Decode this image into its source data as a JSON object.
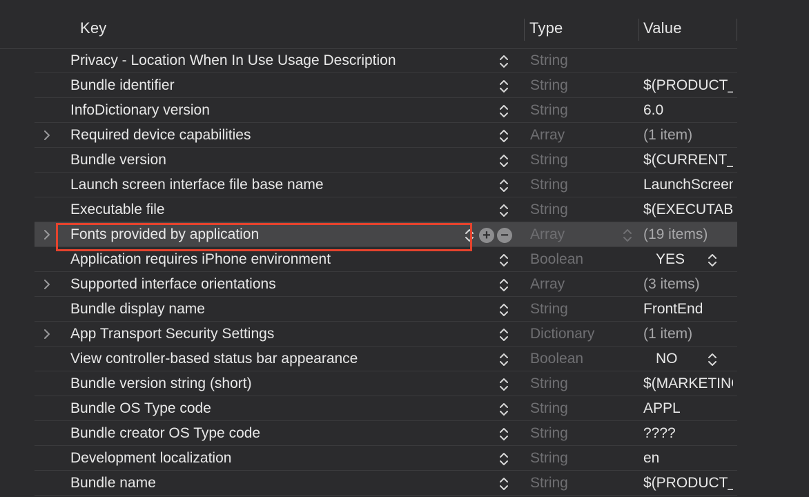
{
  "header": {
    "key_label": "Key",
    "type_label": "Type",
    "value_label": "Value"
  },
  "rows": [
    {
      "key": "Privacy - Location When In Use Usage Description",
      "type": "String",
      "value": "",
      "expandable": false
    },
    {
      "key": "Bundle identifier",
      "type": "String",
      "value": "$(PRODUCT_BUNDLE_IDENTIFIER)",
      "expandable": false
    },
    {
      "key": "InfoDictionary version",
      "type": "String",
      "value": "6.0",
      "expandable": false
    },
    {
      "key": "Required device capabilities",
      "type": "Array",
      "value": "(1 item)",
      "expandable": true
    },
    {
      "key": "Bundle version",
      "type": "String",
      "value": "$(CURRENT_PROJECT_VERSION)",
      "expandable": false
    },
    {
      "key": "Launch screen interface file base name",
      "type": "String",
      "value": "LaunchScreen",
      "expandable": false
    },
    {
      "key": "Executable file",
      "type": "String",
      "value": "$(EXECUTABLE_NAME)",
      "expandable": false
    },
    {
      "key": "Fonts provided by application",
      "type": "Array",
      "value": "(19 items)",
      "expandable": true,
      "selected": true
    },
    {
      "key": "Application requires iPhone environment",
      "type": "Boolean",
      "value": "YES",
      "expandable": false,
      "bool": true
    },
    {
      "key": "Supported interface orientations",
      "type": "Array",
      "value": "(3 items)",
      "expandable": true
    },
    {
      "key": "Bundle display name",
      "type": "String",
      "value": "FrontEnd",
      "expandable": false
    },
    {
      "key": "App Transport Security Settings",
      "type": "Dictionary",
      "value": "(1 item)",
      "expandable": true
    },
    {
      "key": "View controller-based status bar appearance",
      "type": "Boolean",
      "value": "NO",
      "expandable": false,
      "bool": true
    },
    {
      "key": "Bundle version string (short)",
      "type": "String",
      "value": "$(MARKETING_VERSION)",
      "expandable": false
    },
    {
      "key": "Bundle OS Type code",
      "type": "String",
      "value": "APPL",
      "expandable": false
    },
    {
      "key": "Bundle creator OS Type code",
      "type": "String",
      "value": "????",
      "expandable": false
    },
    {
      "key": "Development localization",
      "type": "String",
      "value": "en",
      "expandable": false
    },
    {
      "key": "Bundle name",
      "type": "String",
      "value": "$(PRODUCT_NAME)",
      "expandable": false
    }
  ],
  "icons": {
    "disclosure": "chevron-right-icon",
    "stepper": "up-down-chevron-icon",
    "add": "plus-circle-icon",
    "remove": "minus-circle-icon"
  },
  "colors": {
    "highlight": "#e5432d",
    "background": "#2b2b2d",
    "selected_row": "#464648"
  }
}
